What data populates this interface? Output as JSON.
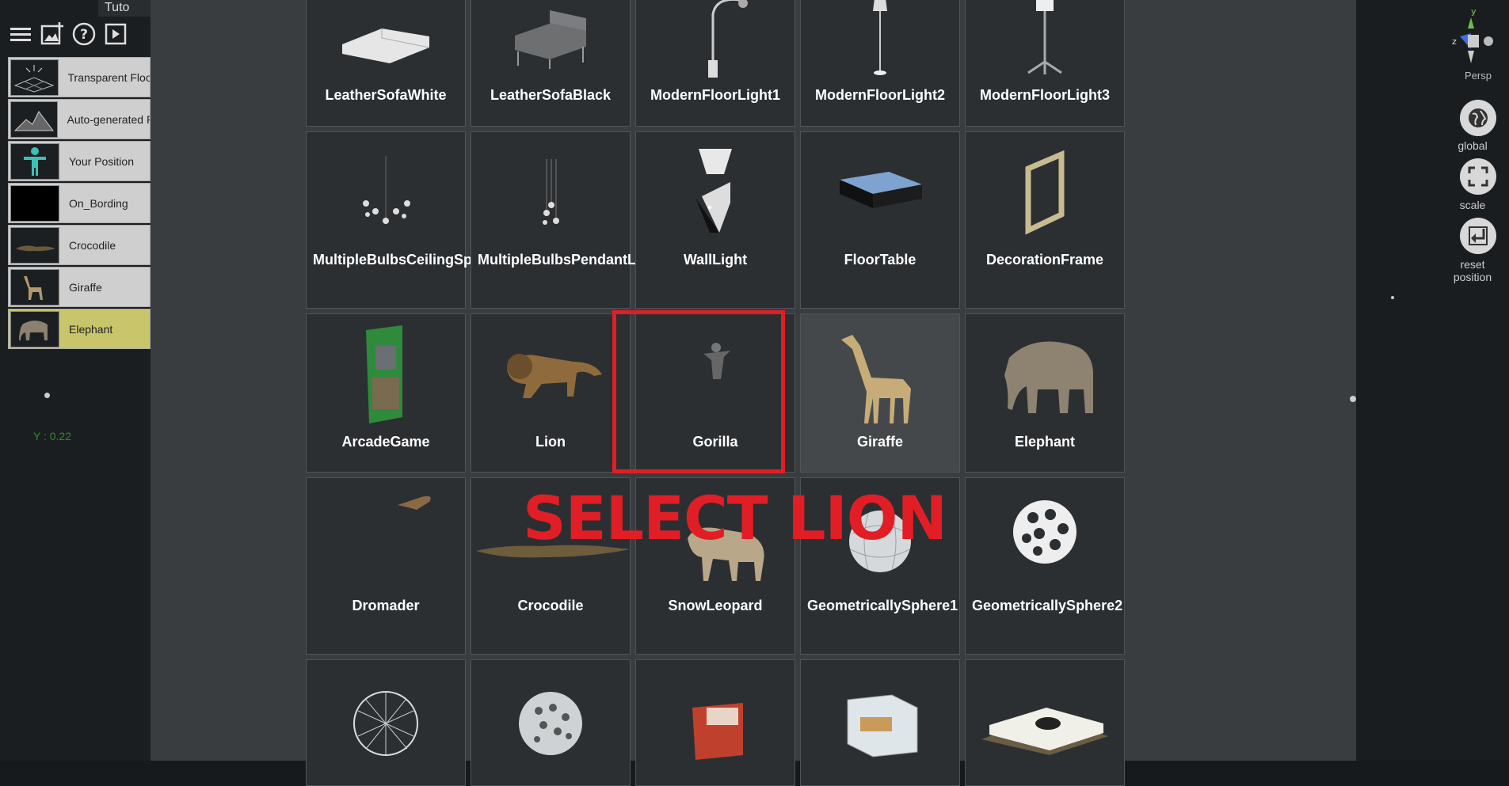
{
  "app": {
    "title_fragment": "Tuto"
  },
  "toolbar": {
    "icons": [
      "menu-icon",
      "add-image-icon",
      "help-icon",
      "play-icon"
    ]
  },
  "layers": [
    {
      "name": "Transparent Floo",
      "thumb": "grid-floor",
      "selected": false
    },
    {
      "name": "Auto-generated F",
      "thumb": "terrain",
      "selected": false
    },
    {
      "name": "Your Position",
      "thumb": "person",
      "selected": false
    },
    {
      "name": "On_Bording",
      "thumb": "black",
      "selected": false
    },
    {
      "name": "Crocodile",
      "thumb": "crocodile",
      "selected": false
    },
    {
      "name": "Giraffe",
      "thumb": "giraffe",
      "selected": false
    },
    {
      "name": "Elephant",
      "thumb": "elephant",
      "selected": true
    }
  ],
  "coord_readout": "Y : 0.22",
  "catalog": [
    [
      "LeatherSofaWhite",
      "LeatherSofaBlack",
      "ModernFloorLight1",
      "ModernFloorLight2",
      "ModernFloorLight3"
    ],
    [
      "MultipleBulbsCeilingSpotlight",
      "MultipleBulbsPendantLights",
      "WallLight",
      "FloorTable",
      "DecorationFrame"
    ],
    [
      "ArcadeGame",
      "Lion",
      "Gorilla",
      "Giraffe",
      "Elephant"
    ],
    [
      "Dromader",
      "Crocodile",
      "SnowLeopard",
      "GeometricallySphere1",
      "GeometricallySphere2"
    ],
    [
      "",
      "",
      "",
      "",
      ""
    ]
  ],
  "hovered_item": "Giraffe",
  "callout": {
    "text": "SELECT LION",
    "color": "#e11e25"
  },
  "viewport": {
    "axis_y": "y",
    "axis_z": "z",
    "projection": "Persp",
    "buttons": [
      {
        "label": "global",
        "icon": "globe-icon"
      },
      {
        "label": "scale",
        "icon": "expand-icon"
      },
      {
        "label": "reset position",
        "icon": "return-icon"
      }
    ]
  }
}
